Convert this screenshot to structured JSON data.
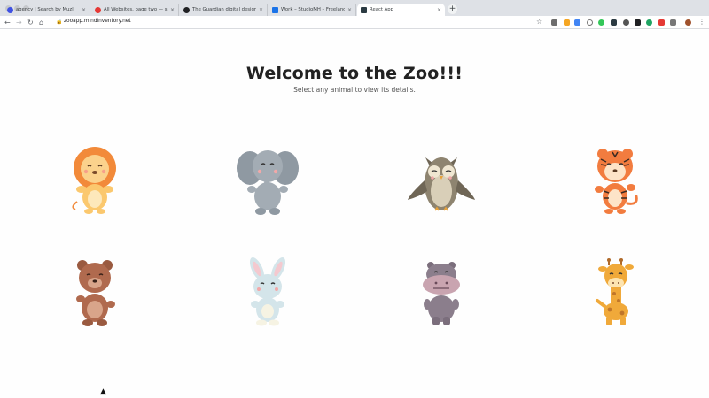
{
  "browser": {
    "tabs": [
      {
        "title": "agency | Search by Muzli",
        "favicon_color": "#3f51e3"
      },
      {
        "title": "All Websites, page two — sites",
        "favicon_color": "#e53935"
      },
      {
        "title": "The Guardian digital design stu",
        "favicon_color": "#202124"
      },
      {
        "title": "Work – StudioMH – Freelance D",
        "favicon_color": "#1a73e8"
      },
      {
        "title": "React App",
        "favicon_color": "#2b3a42"
      }
    ],
    "tab_close": "×",
    "new_tab": "+",
    "url": "zooapp.mindinventory.net"
  },
  "page": {
    "title": "Welcome to the Zoo!!!",
    "subtitle": "Select any animal to view its details."
  },
  "animals": [
    {
      "icon": "lion-icon"
    },
    {
      "icon": "elephant-icon"
    },
    {
      "icon": "owl-icon"
    },
    {
      "icon": "tiger-icon"
    },
    {
      "icon": "bear-icon"
    },
    {
      "icon": "rabbit-icon"
    },
    {
      "icon": "hippo-icon"
    },
    {
      "icon": "giraffe-icon"
    }
  ],
  "colors": {
    "lion": "#f28a3a",
    "elephant": "#9aa4ad",
    "owl": "#8e8470",
    "tiger": "#f27c3f",
    "bear": "#b06a4e",
    "rabbit": "#d4e5ea",
    "hippo": "#8b7e8c",
    "giraffe": "#f0a93a"
  }
}
